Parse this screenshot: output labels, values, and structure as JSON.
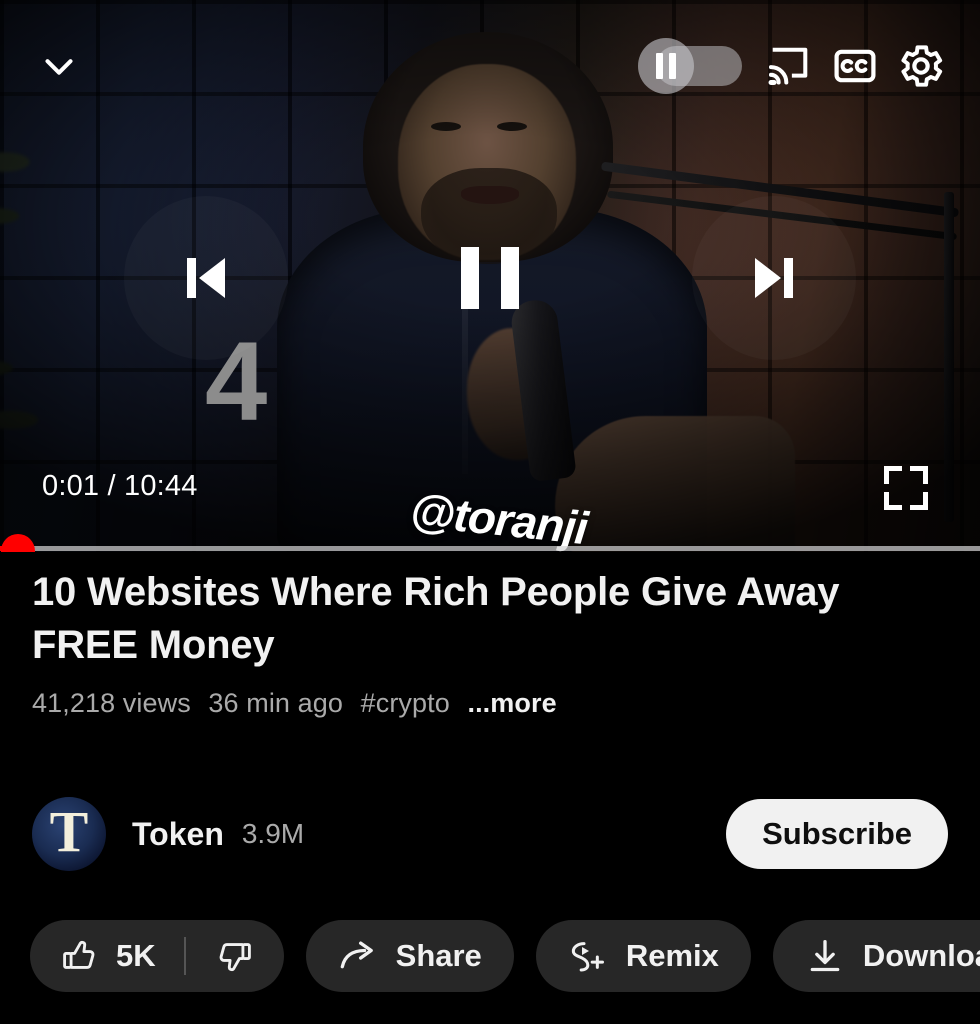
{
  "player": {
    "top_controls": {
      "collapse_icon": "chevron-down-icon",
      "autoplay_icon": "pause-toggle-icon",
      "cast_icon": "cast-icon",
      "captions_icon": "closed-captions-icon",
      "settings_icon": "gear-icon"
    },
    "center_controls": {
      "previous_icon": "skip-previous-icon",
      "pause_icon": "pause-icon",
      "next_icon": "skip-next-icon"
    },
    "current_time": "0:01",
    "duration": "10:44",
    "time_display": "0:01 / 10:44",
    "progress_percent": 0.16,
    "scrubber_color": "#ff0000",
    "fullscreen_icon": "fullscreen-icon",
    "watermark": "@toranji",
    "content_overlay_digit": "4"
  },
  "video": {
    "title": "10 Websites Where Rich People Give Away FREE Money",
    "views": "41,218 views",
    "published": "36 min ago",
    "hashtag": "#crypto",
    "more_label": "...more"
  },
  "channel": {
    "avatar_letter": "T",
    "avatar_bg": "#132a52",
    "name": "Token",
    "subscribers": "3.9M",
    "subscribe_label": "Subscribe",
    "subscribe_bg": "#f1f1f1"
  },
  "actions": {
    "like_count": "5K",
    "like_icon": "thumbs-up-icon",
    "dislike_icon": "thumbs-down-icon",
    "share_label": "Share",
    "share_icon": "share-arrow-icon",
    "remix_label": "Remix",
    "remix_icon": "remix-icon",
    "download_label": "Download",
    "download_icon": "download-arrow-icon"
  },
  "theme": {
    "background": "#000000",
    "text_primary": "#f1f1f1",
    "text_secondary": "#aaaaaa",
    "pill_bg": "#272727",
    "accent_red": "#ff0000"
  }
}
